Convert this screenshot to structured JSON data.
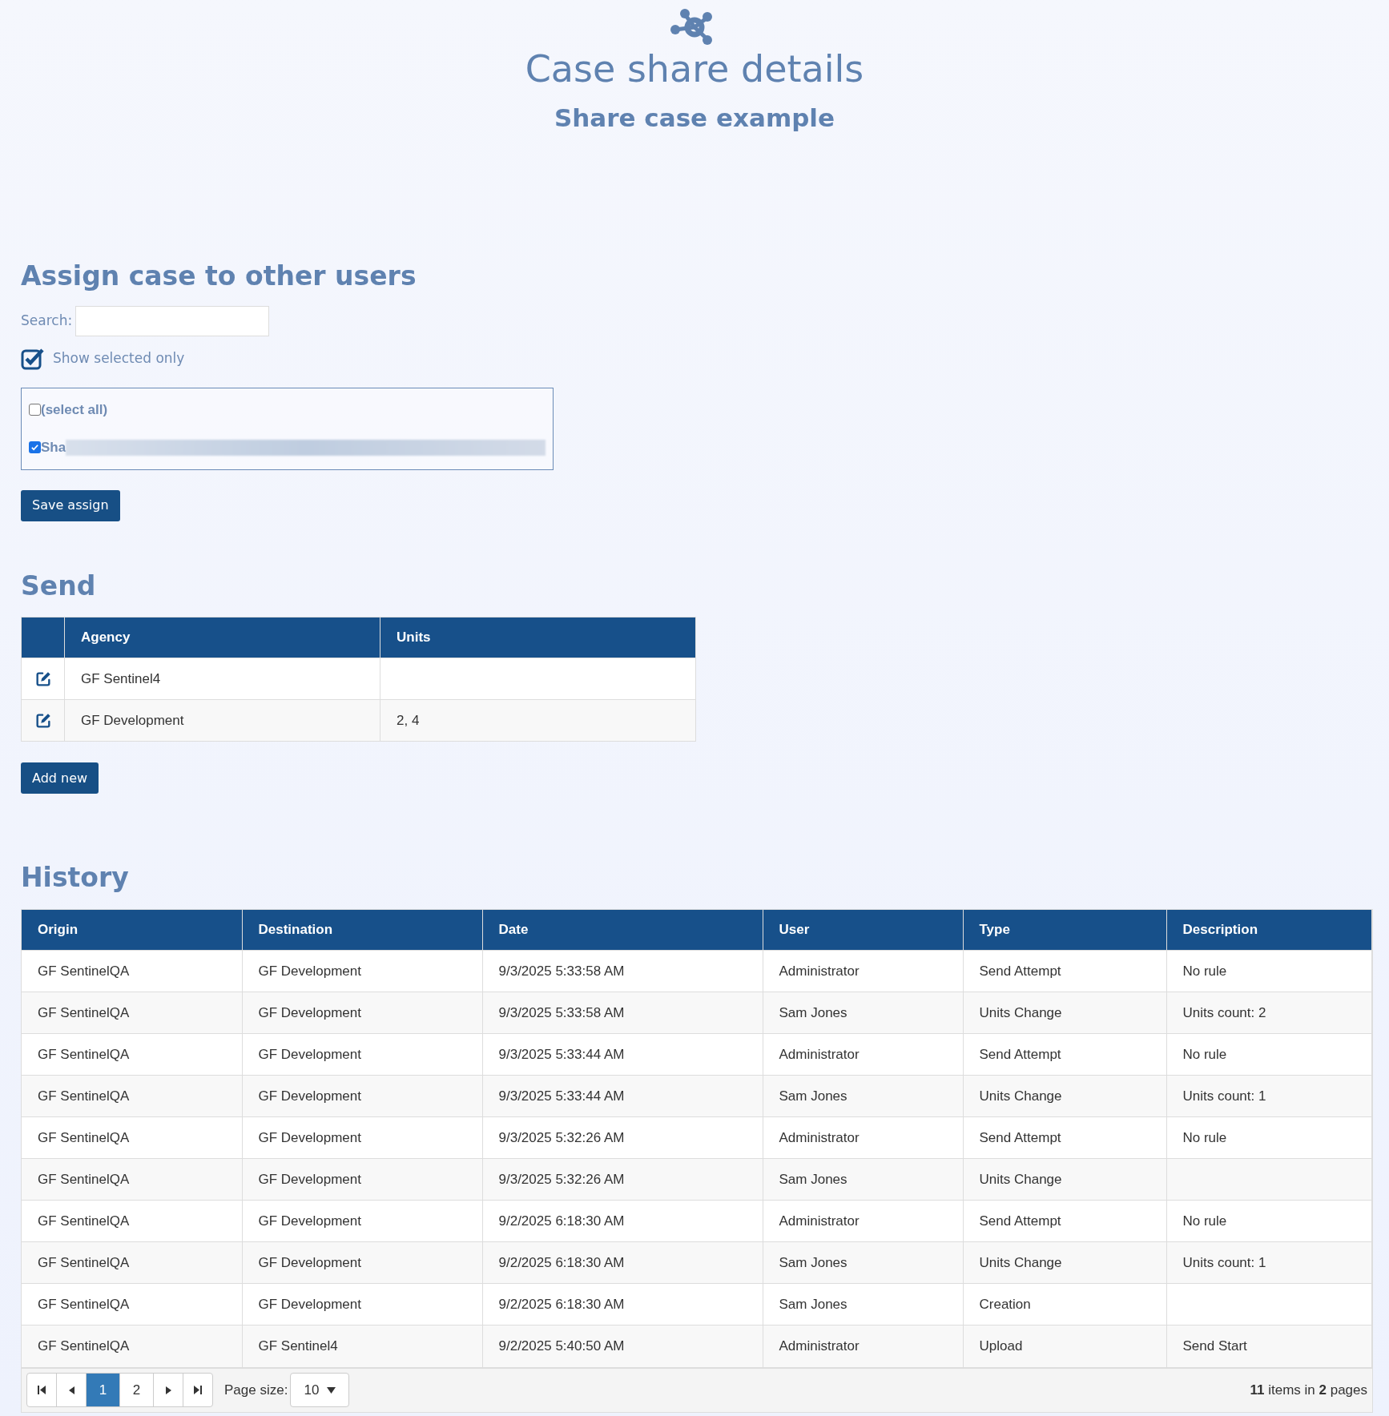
{
  "header": {
    "title": "Case share details",
    "subtitle": "Share case example"
  },
  "assign": {
    "heading": "Assign case to other users",
    "search": {
      "label": "Search:"
    },
    "show_selected_only": {
      "label": "Show selected only",
      "checked": true
    },
    "list": [
      {
        "label": "(select all)",
        "checked": false,
        "redacted": false
      },
      {
        "label": "Sha",
        "checked": true,
        "redacted": true
      }
    ],
    "save_button": "Save assign"
  },
  "send": {
    "heading": "Send",
    "columns": [
      "Agency",
      "Units"
    ],
    "rows": [
      {
        "agency": "GF Sentinel4",
        "units": ""
      },
      {
        "agency": "GF Development",
        "units": "2, 4"
      }
    ],
    "add_button": "Add new"
  },
  "history": {
    "heading": "History",
    "columns": [
      "Origin",
      "Destination",
      "Date",
      "User",
      "Type",
      "Description"
    ],
    "rows": [
      [
        "GF SentinelQA",
        "GF Development",
        "9/3/2025 5:33:58 AM",
        "Administrator",
        "Send Attempt",
        "No rule"
      ],
      [
        "GF SentinelQA",
        "GF Development",
        "9/3/2025 5:33:58 AM",
        "Sam Jones",
        "Units Change",
        "Units count: 2"
      ],
      [
        "GF SentinelQA",
        "GF Development",
        "9/3/2025 5:33:44 AM",
        "Administrator",
        "Send Attempt",
        "No rule"
      ],
      [
        "GF SentinelQA",
        "GF Development",
        "9/3/2025 5:33:44 AM",
        "Sam Jones",
        "Units Change",
        "Units count: 1"
      ],
      [
        "GF SentinelQA",
        "GF Development",
        "9/3/2025 5:32:26 AM",
        "Administrator",
        "Send Attempt",
        "No rule"
      ],
      [
        "GF SentinelQA",
        "GF Development",
        "9/3/2025 5:32:26 AM",
        "Sam Jones",
        "Units Change",
        ""
      ],
      [
        "GF SentinelQA",
        "GF Development",
        "9/2/2025 6:18:30 AM",
        "Administrator",
        "Send Attempt",
        "No rule"
      ],
      [
        "GF SentinelQA",
        "GF Development",
        "9/2/2025 6:18:30 AM",
        "Sam Jones",
        "Units Change",
        "Units count: 1"
      ],
      [
        "GF SentinelQA",
        "GF Development",
        "9/2/2025 6:18:30 AM",
        "Sam Jones",
        "Creation",
        ""
      ],
      [
        "GF SentinelQA",
        "GF Sentinel4",
        "9/2/2025 5:40:50 AM",
        "Administrator",
        "Upload",
        "Send Start"
      ]
    ],
    "pager": {
      "pages": [
        {
          "label": "1",
          "selected": true
        },
        {
          "label": "2",
          "selected": false
        }
      ],
      "page_size_label": "Page size:",
      "page_size": "10",
      "summary": "**11** items in **2** pages"
    }
  }
}
